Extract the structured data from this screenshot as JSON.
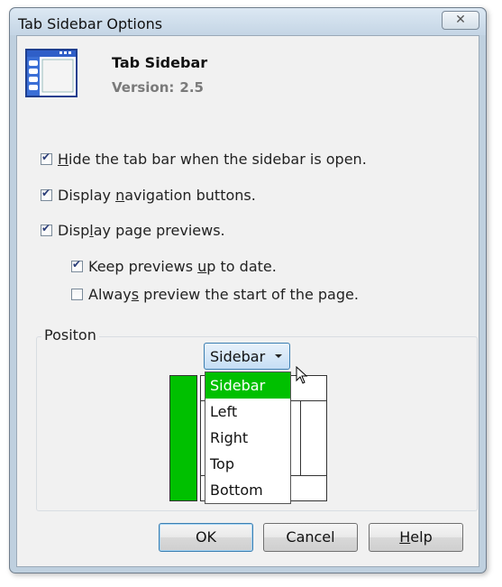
{
  "window": {
    "title": "Tab Sidebar Options",
    "close_glyph": "✕"
  },
  "header": {
    "app_name": "Tab Sidebar",
    "version_label": "Version:",
    "version_value": "2.5",
    "icon": "sidebar-window-icon"
  },
  "options": [
    {
      "pre": "",
      "ul": "H",
      "post": "ide the tab bar when the sidebar is open.",
      "checked": true
    },
    {
      "pre": "Display ",
      "ul": "n",
      "post": "avigation buttons.",
      "checked": true
    },
    {
      "pre": "Disp",
      "ul": "l",
      "post": "ay page previews.",
      "checked": true
    },
    {
      "pre": "Keep previews ",
      "ul": "u",
      "post": "p to date.",
      "checked": true
    },
    {
      "pre": "Alway",
      "ul": "s",
      "post": " preview the start of the page.",
      "checked": false
    }
  ],
  "position_group": {
    "label": "Positon",
    "selected": "Sidebar",
    "dropdown_items": [
      "Sidebar",
      "Left",
      "Right",
      "Top",
      "Bottom"
    ],
    "highlight_color": "#00c000"
  },
  "buttons": {
    "ok": "OK",
    "cancel": "Cancel",
    "help_ul": "H",
    "help_rest": "elp"
  }
}
